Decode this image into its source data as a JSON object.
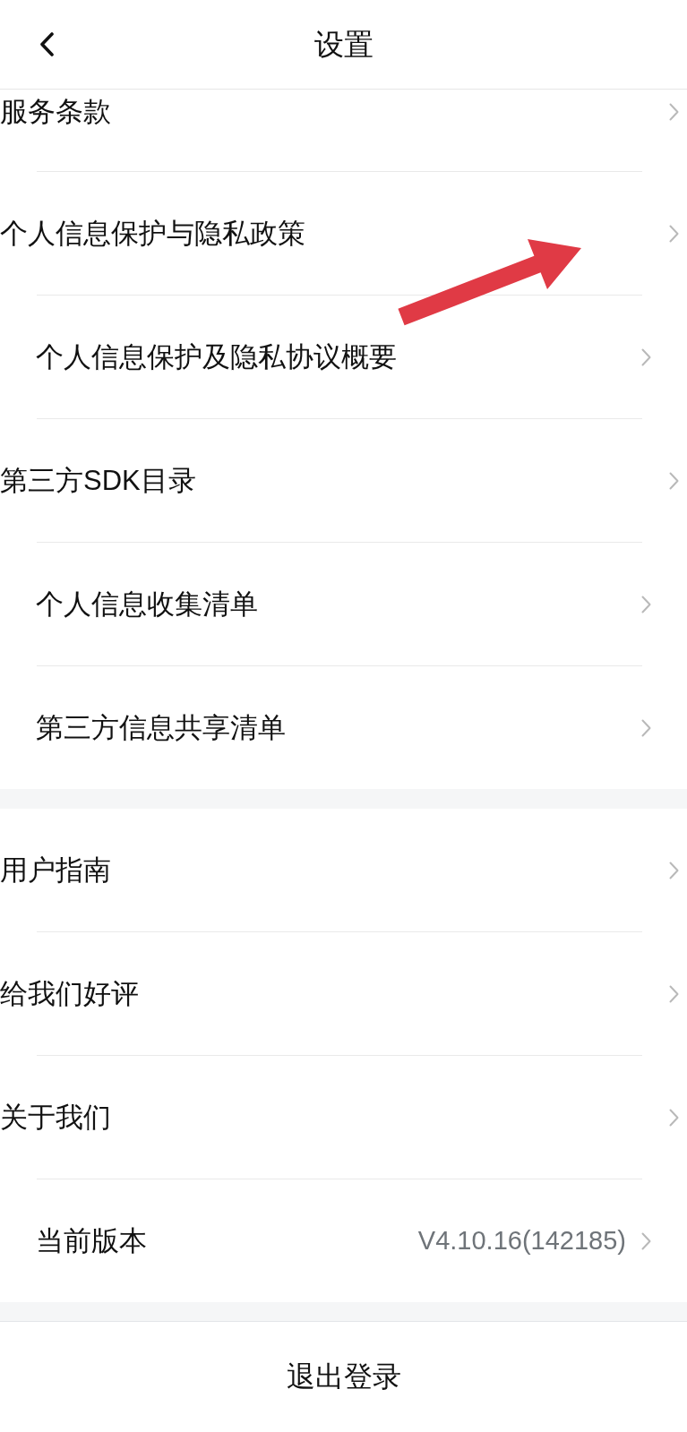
{
  "header": {
    "title": "设置"
  },
  "sections": [
    {
      "items": [
        {
          "label": "服务条款",
          "indented": false
        },
        {
          "label": "个人信息保护与隐私政策",
          "indented": false
        },
        {
          "label": "个人信息保护及隐私协议概要",
          "indented": true
        },
        {
          "label": "第三方SDK目录",
          "indented": false
        },
        {
          "label": "个人信息收集清单",
          "indented": true
        },
        {
          "label": "第三方信息共享清单",
          "indented": true
        }
      ]
    },
    {
      "items": [
        {
          "label": "用户指南",
          "indented": false
        },
        {
          "label": "给我们好评",
          "indented": false
        },
        {
          "label": "关于我们",
          "indented": false
        },
        {
          "label": "当前版本",
          "value": "V4.10.16(142185)",
          "indented": true
        }
      ]
    }
  ],
  "logout": {
    "label": "退出登录"
  }
}
